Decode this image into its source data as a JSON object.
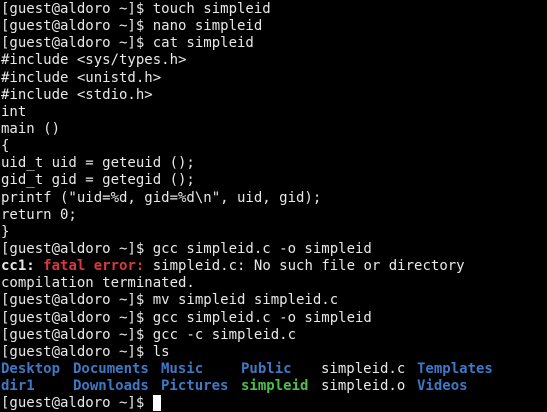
{
  "colors": {
    "background": "#000000",
    "foreground": "#e8e8e8",
    "directory": "#3f78c6",
    "executable": "#4cbf4c",
    "error": "#d83a3a",
    "cursor": "#ffffff"
  },
  "terminal": {
    "lines": [
      {
        "kind": "prompt",
        "prompt": "[guest@aldoro ~]$ ",
        "command": "touch simpleid"
      },
      {
        "kind": "prompt",
        "prompt": "[guest@aldoro ~]$ ",
        "command": "nano simpleid"
      },
      {
        "kind": "prompt",
        "prompt": "[guest@aldoro ~]$ ",
        "command": "cat simpleid"
      },
      {
        "kind": "output",
        "text": "#include <sys/types.h>"
      },
      {
        "kind": "output",
        "text": "#include <unistd.h>"
      },
      {
        "kind": "output",
        "text": "#include <stdio.h>"
      },
      {
        "kind": "output",
        "text": "int"
      },
      {
        "kind": "output",
        "text": "main ()"
      },
      {
        "kind": "output",
        "text": "{"
      },
      {
        "kind": "output",
        "text": "uid_t uid = geteuid ();"
      },
      {
        "kind": "output",
        "text": "gid_t gid = getegid ();"
      },
      {
        "kind": "output",
        "text": "printf (\"uid=%d, gid=%d\\n\", uid, gid);"
      },
      {
        "kind": "output",
        "text": "return 0;"
      },
      {
        "kind": "output",
        "text": "}"
      },
      {
        "kind": "prompt",
        "prompt": "[guest@aldoro ~]$ ",
        "command": "gcc simpleid.c -o simpleid"
      },
      {
        "kind": "error",
        "tool": "cc1:",
        "label": "fatal error:",
        "message": " simpleid.c: No such file or directory"
      },
      {
        "kind": "output",
        "text": "compilation terminated."
      },
      {
        "kind": "prompt",
        "prompt": "[guest@aldoro ~]$ ",
        "command": "mv simpleid simpleid.c"
      },
      {
        "kind": "prompt",
        "prompt": "[guest@aldoro ~]$ ",
        "command": "gcc simpleid.c -o simpleid"
      },
      {
        "kind": "prompt",
        "prompt": "[guest@aldoro ~]$ ",
        "command": "gcc -c simpleid.c"
      },
      {
        "kind": "prompt",
        "prompt": "[guest@aldoro ~]$ ",
        "command": "ls"
      }
    ],
    "ls_rows": [
      [
        {
          "name": "Desktop",
          "type": "directory"
        },
        {
          "name": "Documents",
          "type": "directory"
        },
        {
          "name": "Music",
          "type": "directory"
        },
        {
          "name": "Public",
          "type": "directory"
        },
        {
          "name": "simpleid.c",
          "type": "file"
        },
        {
          "name": "Templates",
          "type": "directory"
        }
      ],
      [
        {
          "name": "dir1",
          "type": "directory"
        },
        {
          "name": "Downloads",
          "type": "directory"
        },
        {
          "name": "Pictures",
          "type": "directory"
        },
        {
          "name": "simpleid",
          "type": "executable"
        },
        {
          "name": "simpleid.o",
          "type": "file"
        },
        {
          "name": "Videos",
          "type": "directory"
        }
      ]
    ],
    "final_prompt": "[guest@aldoro ~]$ "
  }
}
